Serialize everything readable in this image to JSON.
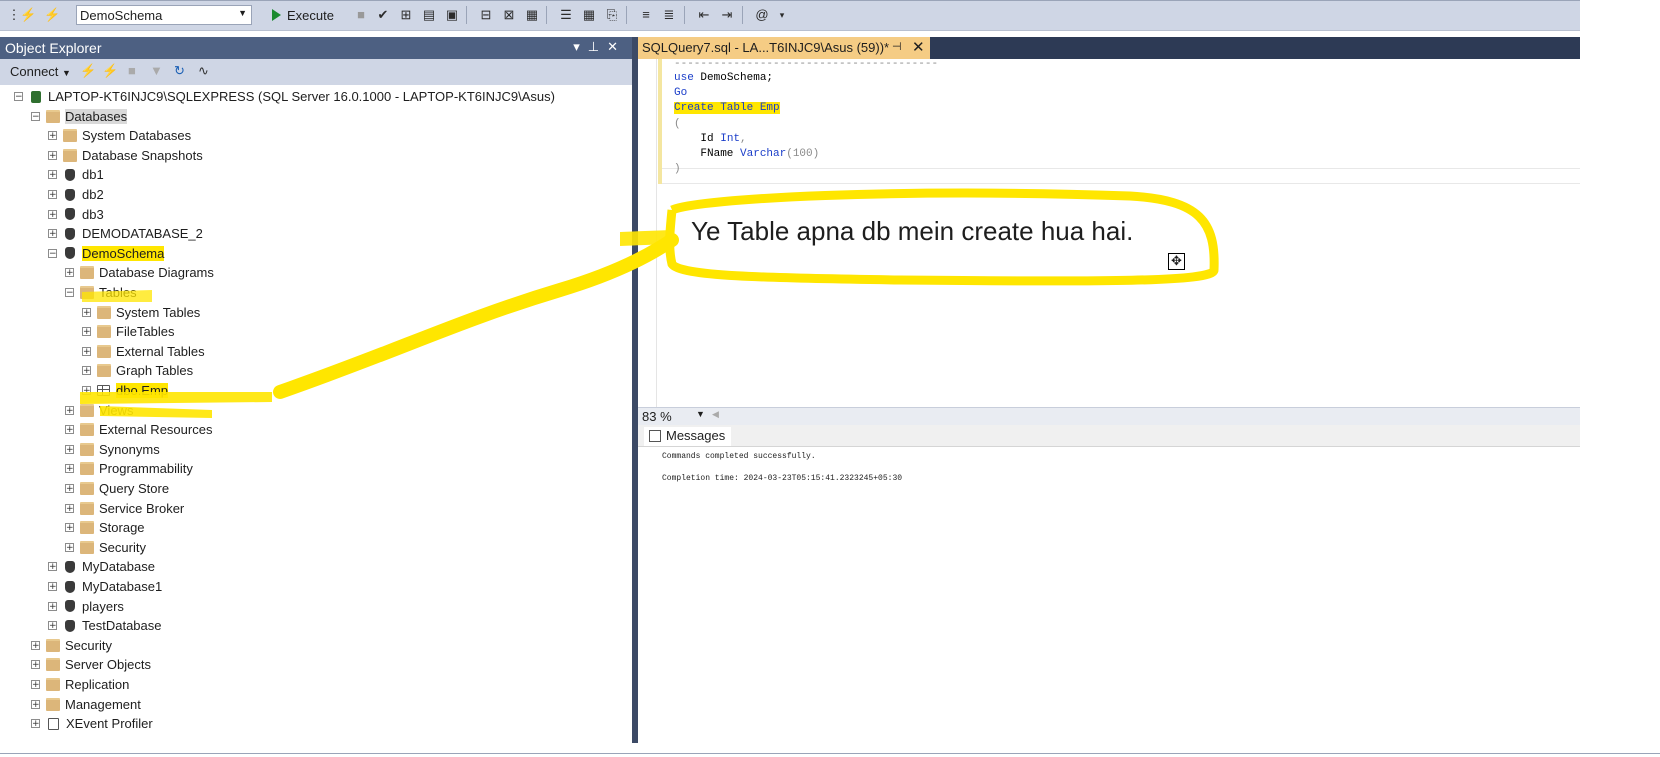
{
  "toolbar": {
    "database_select": "DemoSchema",
    "execute_label": "Execute"
  },
  "object_explorer": {
    "title": "Object Explorer",
    "connect_label": "Connect",
    "tree": [
      {
        "label": "LAPTOP-KT6INJC9\\SQLEXPRESS (SQL Server 16.0.1000 - LAPTOP-KT6INJC9\\Asus)",
        "icon": "server-icon",
        "expanded": true
      },
      {
        "label": "Databases",
        "icon": "folder-icon",
        "expanded": true
      },
      {
        "label": "System Databases",
        "icon": "folder-icon"
      },
      {
        "label": "Database Snapshots",
        "icon": "folder-icon"
      },
      {
        "label": "db1",
        "icon": "database-icon"
      },
      {
        "label": "db2",
        "icon": "database-icon"
      },
      {
        "label": "db3",
        "icon": "database-icon"
      },
      {
        "label": "DEMODATABASE_2",
        "icon": "database-icon"
      },
      {
        "label": "DemoSchema",
        "icon": "database-icon",
        "expanded": true
      },
      {
        "label": "Database Diagrams",
        "icon": "folder-icon"
      },
      {
        "label": "Tables",
        "icon": "folder-icon",
        "expanded": true
      },
      {
        "label": "System Tables",
        "icon": "folder-icon"
      },
      {
        "label": "FileTables",
        "icon": "folder-icon"
      },
      {
        "label": "External Tables",
        "icon": "folder-icon"
      },
      {
        "label": "Graph Tables",
        "icon": "folder-icon"
      },
      {
        "label": "dbo.Emp",
        "icon": "table-icon"
      },
      {
        "label": "Views",
        "icon": "folder-icon"
      },
      {
        "label": "External Resources",
        "icon": "folder-icon"
      },
      {
        "label": "Synonyms",
        "icon": "folder-icon"
      },
      {
        "label": "Programmability",
        "icon": "folder-icon"
      },
      {
        "label": "Query Store",
        "icon": "folder-icon"
      },
      {
        "label": "Service Broker",
        "icon": "folder-icon"
      },
      {
        "label": "Storage",
        "icon": "folder-icon"
      },
      {
        "label": "Security",
        "icon": "folder-icon"
      },
      {
        "label": "MyDatabase",
        "icon": "database-icon"
      },
      {
        "label": "MyDatabase1",
        "icon": "database-icon"
      },
      {
        "label": "players",
        "icon": "database-icon"
      },
      {
        "label": "TestDatabase",
        "icon": "database-icon"
      },
      {
        "label": "Security",
        "icon": "folder-icon"
      },
      {
        "label": "Server Objects",
        "icon": "folder-icon"
      },
      {
        "label": "Replication",
        "icon": "folder-icon"
      },
      {
        "label": "Management",
        "icon": "folder-icon"
      },
      {
        "label": "XEvent Profiler",
        "icon": "xevent-icon"
      }
    ]
  },
  "editor": {
    "tab_title": "SQLQuery7.sql - LA...T6INJC9\\Asus (59))*",
    "code_lines": {
      "dashes": "----------------------------------------",
      "use_kw": "use",
      "use_rest": " DemoSchema;",
      "go": "Go",
      "create": "Create Table Emp",
      "open_paren": "(",
      "id_name": "    Id ",
      "id_type": "Int",
      "id_tail": ",",
      "fname_name": "    FName ",
      "fname_type": "Varchar",
      "fname_tail": "(100)",
      "close_paren": ")"
    },
    "annotation": "Ye Table apna db mein create hua hai.",
    "zoom": "83 %"
  },
  "messages": {
    "tab_label": "Messages",
    "line1": "Commands completed successfully.",
    "line2": "Completion time: 2024-03-23T05:15:41.2323245+05:30"
  },
  "colors": {
    "highlight": "#ffe600",
    "active_tab": "#f5cc84",
    "panel_title": "#4d6082"
  }
}
